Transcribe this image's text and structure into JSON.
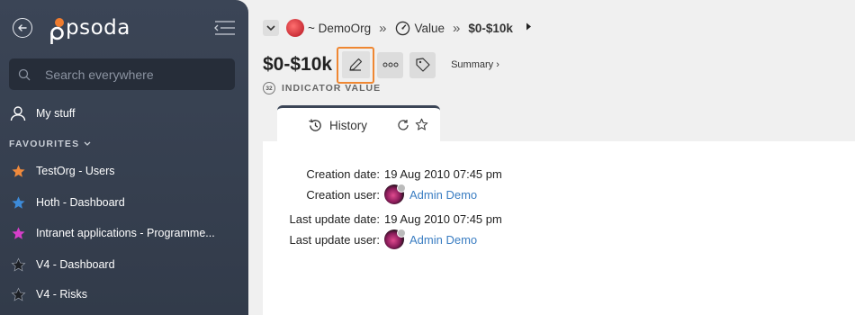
{
  "sidebar": {
    "logo_text": "psoda",
    "search_placeholder": "Search everywhere",
    "my_stuff_label": "My stuff",
    "favourites_header": "FAVOURITES",
    "favourites": [
      {
        "label": "TestOrg - Users",
        "star_color": "#f08a3c"
      },
      {
        "label": "Hoth - Dashboard",
        "star_color": "#3d8bd9"
      },
      {
        "label": "Intranet applications - Programme...",
        "star_color": "#d63fc9"
      },
      {
        "label": "V4 - Dashboard",
        "star_color": "#1c1f24"
      },
      {
        "label": "V4 - Risks",
        "star_color": "#1c1f24"
      }
    ]
  },
  "breadcrumb": {
    "org": "~ DemoOrg",
    "separator": "»",
    "section": "Value",
    "current": "$0-$10k"
  },
  "page": {
    "title": "$0-$10k",
    "summary_link": "Summary ›",
    "type_badge": "32",
    "type_label": "INDICATOR VALUE"
  },
  "tab": {
    "label": "History"
  },
  "history": {
    "creation_date_label": "Creation date:",
    "creation_date_value": "19 Aug 2010 07:45 pm",
    "creation_user_label": "Creation user:",
    "creation_user_value": "Admin Demo",
    "last_update_date_label": "Last update date:",
    "last_update_date_value": "19 Aug 2010 07:45 pm",
    "last_update_user_label": "Last update user:",
    "last_update_user_value": "Admin Demo"
  },
  "colors": {
    "sidebar_bg": "#3b4556",
    "accent_orange": "#ef8732",
    "link_blue": "#3a7dc2"
  }
}
